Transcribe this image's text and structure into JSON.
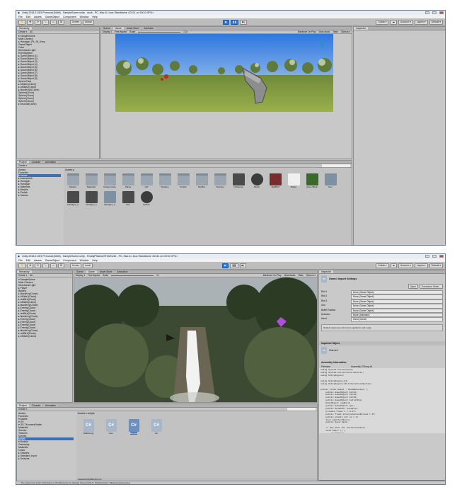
{
  "screens": [
    {
      "title": "Unity 2018.2.15f1 Personal (64bit) - SampleScene.unity - dock - PC, Mac & Linux Standalone <DX11 on DX10 GPU>",
      "menu": [
        "File",
        "Edit",
        "Assets",
        "GameObject",
        "Component",
        "Window",
        "Help"
      ],
      "tools": {
        "center": "Center",
        "global": "Global",
        "collab": "Collab ▾",
        "account": "Account ▾",
        "layers": "Layers ▾",
        "layout": "Default ▾"
      },
      "tabs": {
        "hierarchy": "Hierarchy",
        "scene": "Scene",
        "game": "Game",
        "asset_store": "Asset Store",
        "animator": "Animator",
        "inspector": "Inspector",
        "project": "Project",
        "console": "Console",
        "animation": "Animation"
      },
      "create": "Create ▾",
      "search_all": "All",
      "hierarchy": [
        "▾ SampleScene",
        "Main Camera",
        "▸ Handgun_Plt_18_Smry",
        "GameObject",
        "Cube",
        "Directional Light",
        "EventSystem",
        "▸ GameObject (1)",
        "▸ GameObject (2)",
        "▸ GameObject (3)",
        "▸ GameObject (4)",
        "▸ GameObject (5)",
        "▸ GameObject (6)",
        "▸ GameObject (7)",
        "▸ GameObject (8)",
        "▸ GameObject (9)",
        "SphereTotal",
        "▸ IdSide1(Clone)",
        "▸ IdSide2(Clone)",
        "▸ blackKey2(Clone)",
        "Sphere(Clone)",
        "Sphere(Clone)",
        "Sphere(Clone)",
        "Sphere(Clone)",
        "▸ secondi(Clone)"
      ],
      "game_bar": {
        "display": "Display 1",
        "aspect": "Free Aspect",
        "scale": "Scale",
        "scale_val": "1.2x",
        "max": "Maximize On Play",
        "mute": "Mute Audio",
        "stats": "Stats",
        "gizmos": "Gizmos ▾"
      },
      "score": "0",
      "crumb": "Assets ▸",
      "folders": [
        "Assets",
        "Favorites",
        "▾ Assets",
        "▸ AnimationA",
        "▸ Handgun",
        "▸ Handgun",
        "▸ Materials",
        "▸ Models",
        "▸ Prefab",
        "▸ Scenes"
      ],
      "assets": [
        {
          "n": "Models",
          "t": "folder"
        },
        {
          "n": "Materials",
          "t": "folder"
        },
        {
          "n": "Dialog Guide",
          "t": "folder"
        },
        {
          "n": "Plants",
          "t": "folder"
        },
        {
          "n": "Gift",
          "t": "folder"
        },
        {
          "n": "Shaders",
          "t": "folder"
        },
        {
          "n": "Scripts",
          "t": "folder"
        },
        {
          "n": "SkyBox",
          "t": "folder"
        },
        {
          "n": "Textures",
          "t": "folder"
        },
        {
          "n": "Cubemap",
          "t": "dark"
        },
        {
          "n": "Bomb",
          "t": "sphere"
        },
        {
          "n": "RedBird",
          "t": "red"
        },
        {
          "n": "Bullet",
          "t": "white"
        },
        {
          "n": "green Block",
          "t": "green"
        },
        {
          "n": "Gun",
          "t": "prefab"
        },
        {
          "n": "Handgun_1",
          "t": "dark"
        },
        {
          "n": "Handgun_1",
          "t": "dark"
        },
        {
          "n": "Handgun_1",
          "t": "prefab"
        },
        {
          "n": "Gun",
          "t": "dark"
        },
        {
          "n": "Sphere",
          "t": "sphere"
        }
      ]
    },
    {
      "title": "Unity 2018.2.15f1 Personal (64bit) - SampleScene.unity - FinallyPhisicsOfThisTurtle - PC, Mac & Linux Standalone <DX11 on DX10 GPU>",
      "menu": [
        "File",
        "Edit",
        "Assets",
        "GameObject",
        "Component",
        "Window",
        "Help"
      ],
      "tools": {
        "center": "Center",
        "global": "Local",
        "collab": "Collab ▾",
        "account": "Account ▾",
        "layers": "Layers ▾",
        "layout": "Default ▾"
      },
      "tabs": {
        "hierarchy": "Hierarchy",
        "scene": "Scene",
        "game": "Game",
        "asset_store": "Asset Store",
        "animator": "Animation",
        "inspector": "Inspector",
        "project": "Project",
        "console": "Console",
        "animation": "Animation"
      },
      "create": "Create ▾",
      "search_all": "All",
      "hierarchy": [
        "▾ SampleScene",
        "Main Camera",
        "Directional Light",
        "▸ Player",
        "Ballons",
        "▸ blackKey(Clone)",
        "▸ IdSide1(Clone)",
        "▸ redBird(Clone)",
        "▸ IdSide2(Clone)",
        "▸ blackKey(Clone)",
        "▸ Enemy(Clone)",
        "▸ Enemy(Clone)",
        "▸ redBird(Clone)",
        "▸ blackKey(Clone)",
        "▸ Enemy(Clone)",
        "▸ Enemy(Clone)",
        "▸ Enemy(Clone)",
        "▸ Enemy(Clone)",
        "▸ blackKey(Clone)",
        "▸ redBird(Clone)",
        "▸ IdSide2(Clone)"
      ],
      "game_bar": {
        "display": "Display 1",
        "aspect": "Free Aspect",
        "scale": "Scale",
        "scale_val": "1x",
        "max": "Maximize On Play",
        "mute": "Mute Audio",
        "stats": "Stats",
        "gizmos": "Gizmos ▾"
      },
      "crumb": "Assets ▸ scripts",
      "folders": [
        "Assets",
        "Favorites",
        "▾ Assets",
        "▾ OS",
        "▾ OS-TKunnersRealm",
        "Materials",
        "Scenes",
        "Textures",
        "Scenes",
        "scripts",
        "▾ Models",
        "Gameplay",
        "Materials",
        "Crane",
        "▸ Shaders",
        "▸ Standard_Input",
        "▸ Textures"
      ],
      "scripts": [
        {
          "n": "DefMoving",
          "sel": false
        },
        {
          "n": "Gun",
          "sel": false
        },
        {
          "n": "Bomber",
          "sel": true
        },
        {
          "n": "Jar",
          "sel": false
        }
      ],
      "path": "Assets/scripts/Bomber.cs",
      "status": "The referenced script (Unknown) on this Behaviour is missing! Scene OnGUI / ShadowCasts / Metalness/Glossiness",
      "inspector": {
        "name": "Game1 Import Settings",
        "open": "Open",
        "execution": "Execution Order...",
        "rows": [
          {
            "k": "Bird 1",
            "v": "None (Game Object)"
          },
          {
            "k": "Bird 2",
            "v": "None (Game Object)"
          },
          {
            "k": "Bird 3",
            "v": "None (Game Object)"
          },
          {
            "k": "Gun",
            "v": "None (Game Object)"
          },
          {
            "k": "Bullet Position",
            "v": "None (Game Object)"
          },
          {
            "k": "Animator",
            "v": "None (Animator)"
          },
          {
            "k": "Hand",
            "v": "Hand (Game)"
          }
        ],
        "note": "Default references will only be applied in edit mode.",
        "imported": "Imported Object",
        "obj": "Game1",
        "asm_title": "Assembly Information",
        "asm_k": "Filename",
        "asm_v": "Assembly-CSharp.dll",
        "code": "using System.Collections;\nusing System.Collections.Generic;\nusing UnityEngine;\n\nusing UnityEngine.UI;\nusing UnityEngine.VR.InteractionSystem;\n\npublic class Game1 : MonoBehaviour {\n    public GameObject bird1;\n    public GameObject bird2;\n    public GameObject bird3;\n    public GameObject bulletPos;\n    GameObject newBird;\n    public GameObject gun;\n    public Animator animator;\n    private float t = 0.0f;\n    public float interpolationPeriod = 4f;\n    public static int sc = 0;\n    Text mainTextScore;\n    public Hand hand;\n\n    // Use this for initialization\n    void Start () {\n        startFrm();",
        "labels": "Asset Labels"
      }
    }
  ]
}
